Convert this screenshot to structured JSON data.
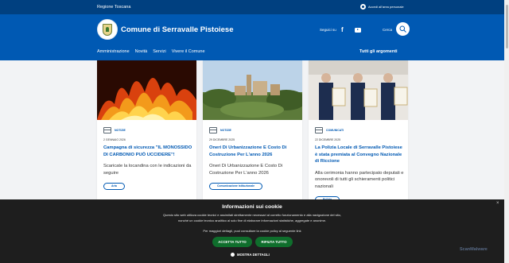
{
  "topbar": {
    "region": "Regione Toscana",
    "personal_area": "Accedi all'area personale"
  },
  "header": {
    "title": "Comune di Serravalle Pistoiese",
    "follow_label": "Seguici su",
    "search_label": "Cerca",
    "social": [
      "facebook-icon",
      "youtube-icon"
    ]
  },
  "nav": {
    "items": [
      "Amministrazione",
      "Novità",
      "Servizi",
      "Vivere il Comune"
    ],
    "all_topics": "Tutti gli argomenti"
  },
  "cards": [
    {
      "category": "NOTIZIE",
      "date": "2 GENNAIO 2026",
      "title": "Campagna di sicurezza \"IL MONOSSIDO DI CARBONIO PUÒ UCCIDERE\"!",
      "description": "Scaricate la locandina con le indicazioni da seguire",
      "tag": "Aria"
    },
    {
      "category": "NOTIZIE",
      "date": "29 DICEMBRE 2025",
      "title": "Oneri Di Urbanizzazione E Costo Di Costruzione Per L'anno 2026",
      "description": "Oneri Di Urbanizzazione E Costo Di Costruzione Per L'anno 2026",
      "tag": "Comunicazione istituzionale"
    },
    {
      "category": "COMUNICATI",
      "date": "22 DICEMBRE 2025",
      "title": "La Polizia Locale di Serravalle Pistoiese è stata premiata al Convegno Nazionale di Riccione",
      "description": "Alla cerimonia hanno partecipato deputati e onorevoli di tutti gli schieramenti politici nazionali",
      "tag": "Polizia"
    }
  ],
  "cookie": {
    "title": "Informazioni sui cookie",
    "text": "Questo sito web utilizza cookie tecnici e assimilati strettamente necessari al corretto funzionamento e alla navigazione del sito, nonché un cookie tecnico analitico al solo fine di elaborare informazioni statistiche, aggregate e anonime.",
    "more": "Per maggiori dettagli, puoi consultare la cookie policy al seguente link",
    "accept": "ACCETTA TUTTO",
    "reject": "RIFIUTA TUTTO",
    "details": "MOSTRA DETTAGLI",
    "close": "×",
    "watermark": "ScanMalware"
  },
  "colors": {
    "primary": "#0059b3",
    "topbar": "#004080",
    "cookie_bg": "#1e1e1e",
    "button_green": "#0f6e2c"
  }
}
